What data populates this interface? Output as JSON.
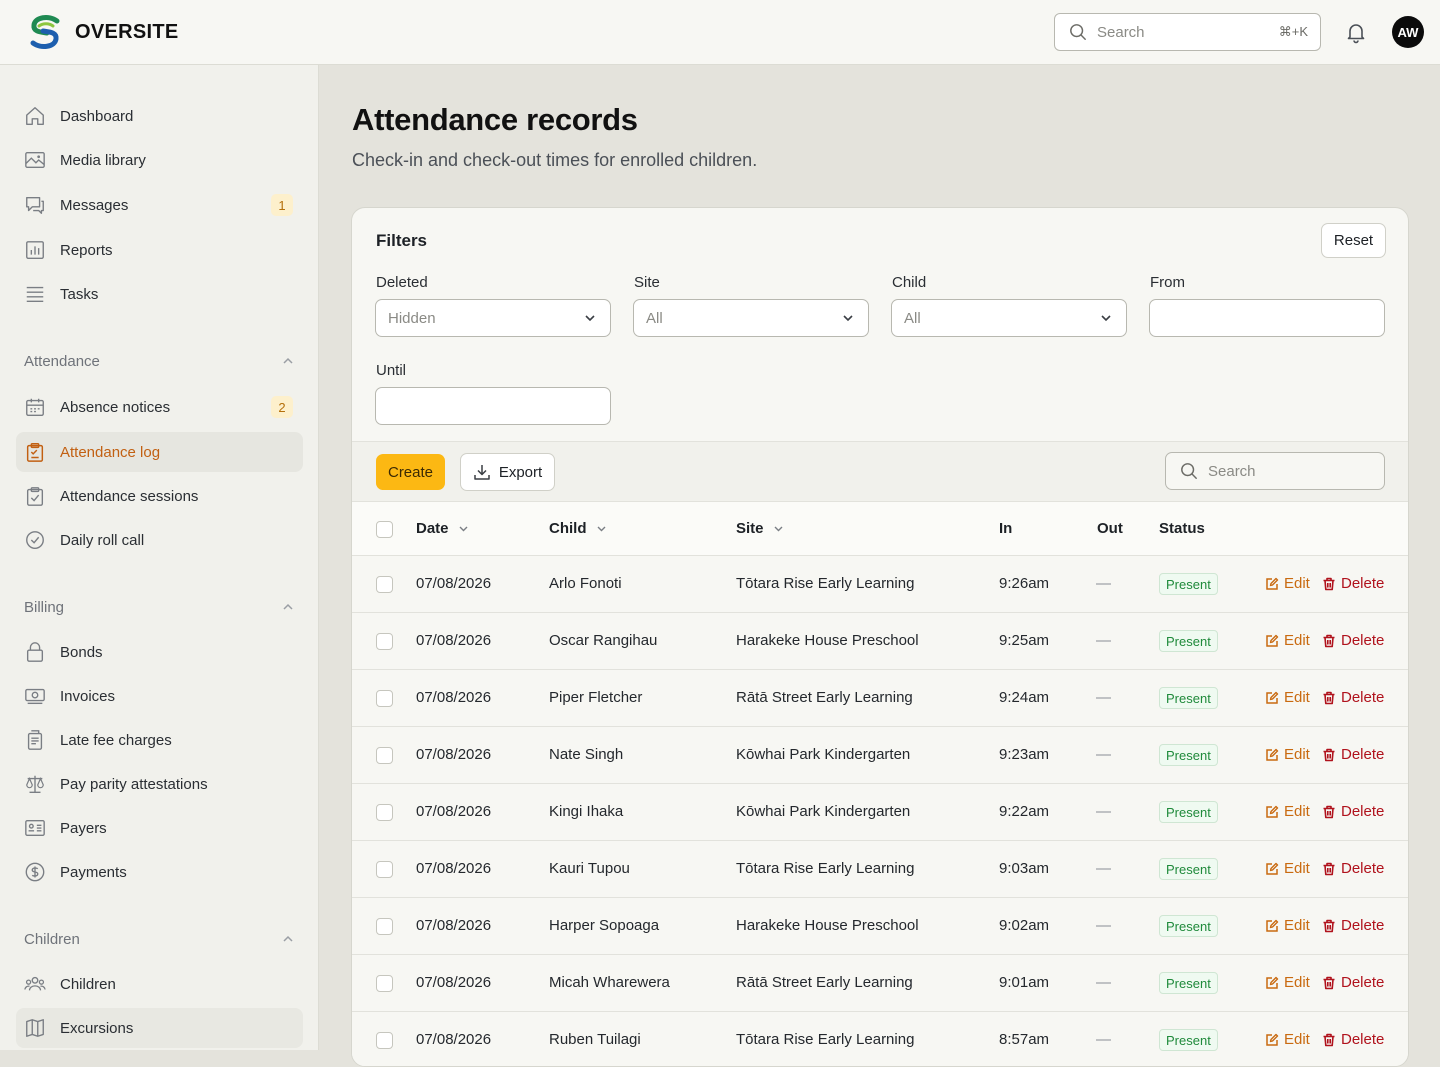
{
  "app": {
    "name": "OVERSITE"
  },
  "topbar": {
    "search_placeholder": "Search",
    "search_shortcut": "⌘+K",
    "avatar_initials": "AW"
  },
  "sidebar": {
    "main_items": [
      {
        "label": "Dashboard",
        "icon": "home-icon"
      },
      {
        "label": "Media library",
        "icon": "image-icon"
      },
      {
        "label": "Messages",
        "icon": "chat-icon",
        "badge": "1"
      },
      {
        "label": "Reports",
        "icon": "chart-icon"
      },
      {
        "label": "Tasks",
        "icon": "list-icon"
      }
    ],
    "sections": [
      {
        "title": "Attendance",
        "items": [
          {
            "label": "Absence notices",
            "icon": "calendar-icon",
            "badge": "2"
          },
          {
            "label": "Attendance log",
            "icon": "clipboard-icon",
            "active": true
          },
          {
            "label": "Attendance sessions",
            "icon": "clipboard-check-icon"
          },
          {
            "label": "Daily roll call",
            "icon": "check-circle-icon"
          }
        ]
      },
      {
        "title": "Billing",
        "items": [
          {
            "label": "Bonds",
            "icon": "lock-icon"
          },
          {
            "label": "Invoices",
            "icon": "banknote-icon"
          },
          {
            "label": "Late fee charges",
            "icon": "document-icon"
          },
          {
            "label": "Pay parity attestations",
            "icon": "scale-icon"
          },
          {
            "label": "Payers",
            "icon": "id-card-icon"
          },
          {
            "label": "Payments",
            "icon": "dollar-icon"
          }
        ]
      },
      {
        "title": "Children",
        "items": [
          {
            "label": "Children",
            "icon": "users-icon"
          },
          {
            "label": "Excursions",
            "icon": "map-icon"
          }
        ]
      }
    ]
  },
  "page": {
    "title": "Attendance records",
    "subtitle": "Check-in and check-out times for enrolled children."
  },
  "filters": {
    "title": "Filters",
    "reset_label": "Reset",
    "deleted": {
      "label": "Deleted",
      "value": "Hidden"
    },
    "site": {
      "label": "Site",
      "value": "All"
    },
    "child": {
      "label": "Child",
      "value": "All"
    },
    "from": {
      "label": "From",
      "value": ""
    },
    "until": {
      "label": "Until",
      "value": ""
    }
  },
  "toolbar": {
    "create_label": "Create",
    "export_label": "Export",
    "search_placeholder": "Search"
  },
  "table": {
    "columns": [
      "Date",
      "Child",
      "Site",
      "In",
      "Out",
      "Status"
    ],
    "edit_label": "Edit",
    "delete_label": "Delete",
    "rows": [
      {
        "date": "07/08/2026",
        "child": "Arlo Fonoti",
        "site": "Tōtara Rise Early Learning",
        "in": "9:26am",
        "out": "—",
        "status": "Present"
      },
      {
        "date": "07/08/2026",
        "child": "Oscar Rangihau",
        "site": "Harakeke House Preschool",
        "in": "9:25am",
        "out": "—",
        "status": "Present"
      },
      {
        "date": "07/08/2026",
        "child": "Piper Fletcher",
        "site": "Rātā Street Early Learning",
        "in": "9:24am",
        "out": "—",
        "status": "Present"
      },
      {
        "date": "07/08/2026",
        "child": "Nate Singh",
        "site": "Kōwhai Park Kindergarten",
        "in": "9:23am",
        "out": "—",
        "status": "Present"
      },
      {
        "date": "07/08/2026",
        "child": "Kingi Ihaka",
        "site": "Kōwhai Park Kindergarten",
        "in": "9:22am",
        "out": "—",
        "status": "Present"
      },
      {
        "date": "07/08/2026",
        "child": "Kauri Tupou",
        "site": "Tōtara Rise Early Learning",
        "in": "9:03am",
        "out": "—",
        "status": "Present"
      },
      {
        "date": "07/08/2026",
        "child": "Harper Sopoaga",
        "site": "Harakeke House Preschool",
        "in": "9:02am",
        "out": "—",
        "status": "Present"
      },
      {
        "date": "07/08/2026",
        "child": "Micah Wharewera",
        "site": "Rātā Street Early Learning",
        "in": "9:01am",
        "out": "—",
        "status": "Present"
      },
      {
        "date": "07/08/2026",
        "child": "Ruben Tuilagi",
        "site": "Tōtara Rise Early Learning",
        "in": "8:57am",
        "out": "—",
        "status": "Present"
      }
    ]
  },
  "colors": {
    "accent": "#fcb813",
    "active_nav": "#c26012",
    "edit": "#c96a10",
    "delete": "#b0121c",
    "status_present": "#1f8a3b"
  }
}
